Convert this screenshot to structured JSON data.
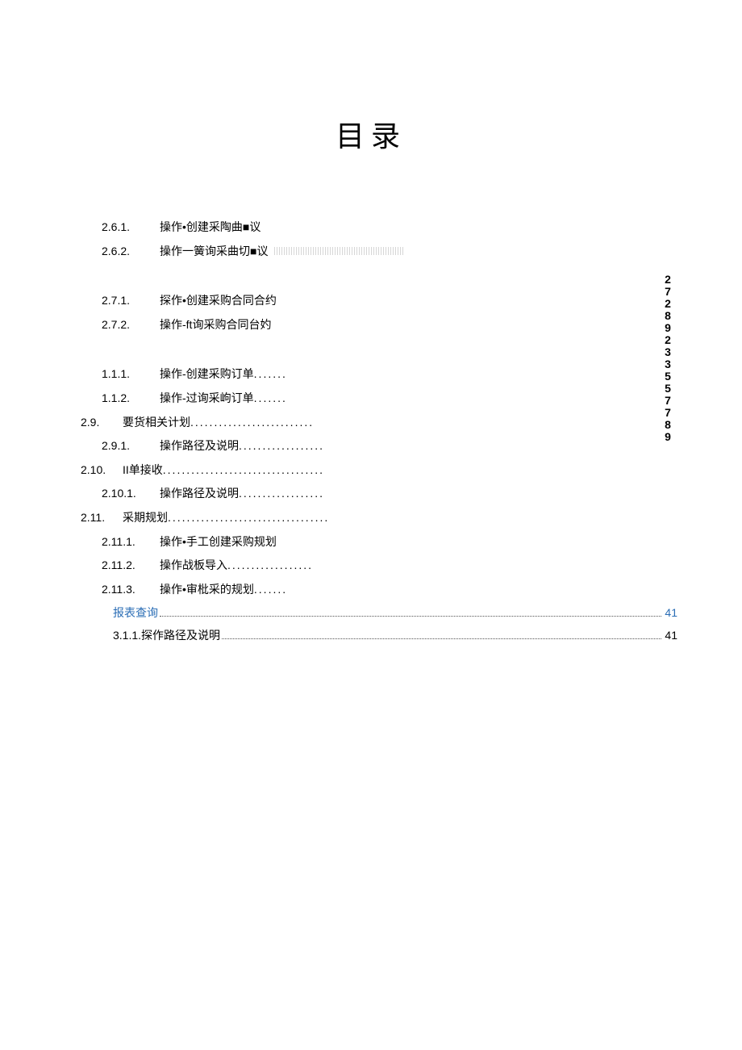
{
  "title": "目录",
  "entries": [
    {
      "num": "2.6.1.",
      "text": "操作•创建采陶曲■议",
      "level": 3,
      "trail": ""
    },
    {
      "num": "2.6.2.",
      "text": "操作一簧询采曲切■议",
      "level": 3,
      "trail": "stipple"
    },
    {
      "num": "2.7.1.",
      "text": "探作•创建采购合同合约",
      "level": 3,
      "trail": "",
      "gapAbove": true
    },
    {
      "num": "2.7.2.",
      "text": "操作-ft询采购合同台妁",
      "level": 3,
      "trail": ""
    },
    {
      "num": "1.1.1.",
      "text": "操作-创建采购订单",
      "level": 3,
      "trail": "short",
      "gapAbove": true
    },
    {
      "num": "1.1.2.",
      "text": "操作-过询采岣订单",
      "level": 3,
      "trail": "short"
    },
    {
      "num": "2.9.",
      "text": "要货相关计划",
      "level": 2,
      "trail": "long"
    },
    {
      "num": "2.9.1.",
      "text": "操作路径及说明",
      "level": 3,
      "trail": "med"
    },
    {
      "num": "2.10.",
      "text": "II单接收",
      "level": 2,
      "trail": "vlong"
    },
    {
      "num": "2.10.1.",
      "text": "操作路径及说明",
      "level": 3,
      "trail": "med"
    },
    {
      "num": "2.11.",
      "text": "采期规划",
      "level": 2,
      "trail": "vlong"
    },
    {
      "num": "2.11.1.",
      "text": "操作•手工创建采购规划",
      "level": 3,
      "trail": ""
    },
    {
      "num": "2.11.2.",
      "text": "操作战板导入",
      "level": 3,
      "trail": "med"
    },
    {
      "num": "2.11.3.",
      "text": "操作•审枇采的规划",
      "level": 3,
      "trail": "short"
    }
  ],
  "fullRows": [
    {
      "label": "报表查询",
      "page": "41",
      "link": true
    },
    {
      "label": "3.1.1.探作路径及说明",
      "page": "41",
      "link": false
    }
  ],
  "verticalNums": [
    "2728",
    "9233557789"
  ]
}
